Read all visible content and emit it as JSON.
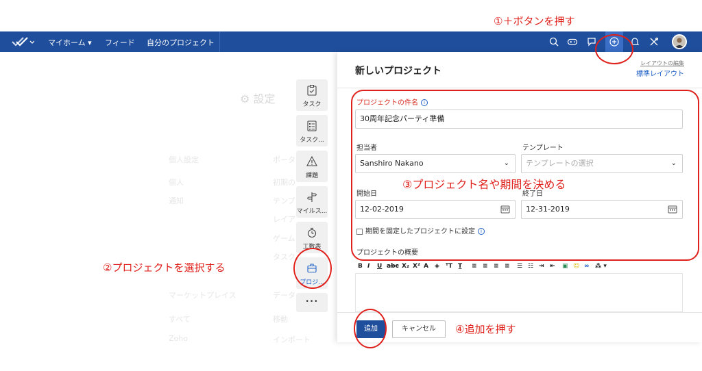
{
  "topnav": {
    "home": "マイホーム ▾",
    "feed": "フィード",
    "my_projects": "自分のプロジェクト"
  },
  "background": {
    "title": "設定",
    "rows": [
      {
        "left": "個人設定",
        "right": "ポータ"
      },
      {
        "left": "個人",
        "right": "初期の"
      },
      {
        "left": "通知",
        "right": "テンプ"
      },
      {
        "left": "",
        "right": "レイア"
      },
      {
        "left": "",
        "right": "ゲーム"
      },
      {
        "left": "",
        "right": "タスク"
      },
      {
        "left": "マーケットプレイス",
        "right": "データ"
      },
      {
        "left": "すべて",
        "right": "移動"
      },
      {
        "left": "Zoho",
        "right": "インポート"
      }
    ]
  },
  "rail": {
    "items": [
      {
        "label": "タスク",
        "icon": "task-icon"
      },
      {
        "label": "タスク...",
        "icon": "tasklist-icon"
      },
      {
        "label": "課題",
        "icon": "warning-icon"
      },
      {
        "label": "マイルス...",
        "icon": "milestone-icon"
      },
      {
        "label": "工数表",
        "icon": "timer-icon"
      },
      {
        "label": "プロジ...",
        "icon": "briefcase-icon"
      },
      {
        "label": "•••",
        "icon": "more-icon"
      }
    ]
  },
  "panel": {
    "title": "新しいプロジェクト",
    "layout_edit": "レイアウトの編集",
    "layout_standard": "標準レイアウト",
    "name_label": "プロジェクトの件名",
    "name_value": "30周年記念パーティ準備",
    "owner_label": "担当者",
    "owner_value": "Sanshiro Nakano",
    "template_label": "テンプレート",
    "template_placeholder": "テンプレートの選択",
    "start_label": "開始日",
    "start_value": "12-02-2019",
    "end_label": "終了日",
    "end_value": "12-31-2019",
    "fixed_period_label": "期間を固定したプロジェクトに設定",
    "overview_label": "プロジェクトの概要",
    "add_button": "追加",
    "cancel_button": "キャンセル"
  },
  "annotations": {
    "step1": "①＋ボタンを押す",
    "step2": "②プロジェクトを選択する",
    "step3": "③プロジェクト名や期間を決める",
    "step4": "④追加を押す"
  },
  "colors": {
    "nav": "#1f4e9c",
    "accent": "#1f5fc7",
    "annotation": "#e0201b",
    "required": "#d93025"
  }
}
